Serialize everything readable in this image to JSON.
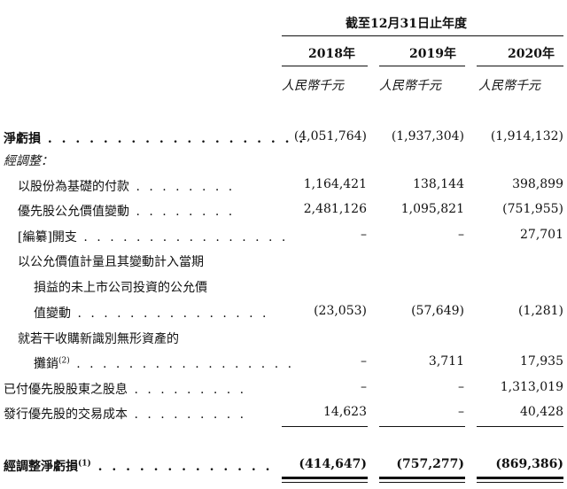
{
  "header": {
    "period": "截至12月31日止年度",
    "years": [
      "2018年",
      "2019年",
      "2020年"
    ],
    "unit": "人民幣千元"
  },
  "rows": [
    {
      "label": "淨虧損",
      "values": [
        "(4,051,764)",
        "(1,937,304)",
        "(1,914,132)"
      ]
    },
    {
      "label": "經調整：",
      "values": [
        "",
        "",
        ""
      ]
    },
    {
      "label": "以股份為基礎的付款",
      "values": [
        "1,164,421",
        "138,144",
        "398,899"
      ]
    },
    {
      "label": "優先股公允價值變動",
      "values": [
        "2,481,126",
        "1,095,821",
        "(751,955)"
      ]
    },
    {
      "label": "[編纂]開支",
      "values": [
        "–",
        "–",
        "27,701"
      ]
    },
    {
      "label_lines": [
        "以公允價值計量且其變動計入當期",
        "損益的未上市公司投資的公允價",
        "值變動"
      ],
      "values": [
        "(23,053)",
        "(57,649)",
        "(1,281)"
      ]
    },
    {
      "label_lines": [
        "就若干收購新識別無形資產的",
        "攤銷"
      ],
      "note": "(2)",
      "values": [
        "–",
        "3,711",
        "17,935"
      ]
    },
    {
      "label": "已付優先股股東之股息",
      "values": [
        "–",
        "–",
        "1,313,019"
      ]
    },
    {
      "label": "發行優先股的交易成本",
      "values": [
        "14,623",
        "–",
        "40,428"
      ]
    },
    {
      "label": "經調整淨虧損",
      "note": "(1)",
      "values": [
        "(414,647)",
        "(757,277)",
        "(869,386)"
      ]
    }
  ]
}
